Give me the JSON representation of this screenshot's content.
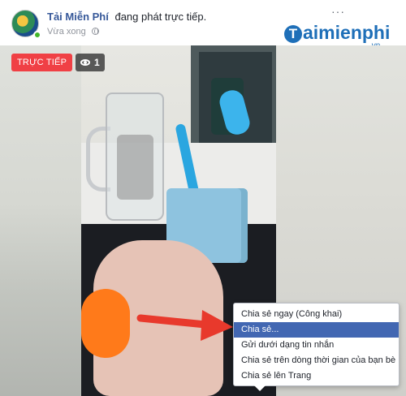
{
  "post": {
    "author": "Tải Miễn Phí",
    "action": "đang phát trực tiếp.",
    "time": "Vừa xong",
    "more_icon": "···"
  },
  "brand": {
    "initial": "T",
    "name": "aimienphi",
    "sub": ".vn"
  },
  "video": {
    "live_label": "TRỰC TIẾP",
    "viewer_count": "1"
  },
  "menu": {
    "items": [
      "Chia sẻ ngay (Công khai)",
      "Chia sẻ...",
      "Gửi dưới dạng tin nhắn",
      "Chia sẻ trên dòng thời gian của bạn bè",
      "Chia sẻ lên Trang"
    ],
    "active_index": 1
  },
  "colors": {
    "live_red": "#f04045",
    "menu_highlight": "#4267b2",
    "link_blue": "#365899",
    "arrow_red": "#e8392c"
  }
}
